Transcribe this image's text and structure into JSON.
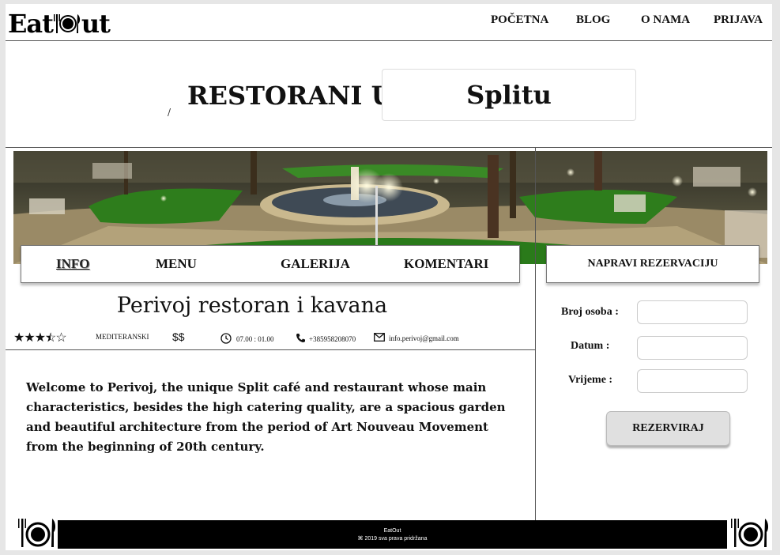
{
  "header": {
    "logo_left": "Eat",
    "logo_right": "ut",
    "nav": [
      "POČETNA",
      "BLOG",
      "O NAMA",
      "PRIJAVA"
    ]
  },
  "hero": {
    "title": "RESTORANI U:",
    "tick": "/",
    "city": "Splitu"
  },
  "tabs": [
    "INFO",
    "MENU",
    "GALERIJA",
    "KOMENTARI"
  ],
  "active_tab": "INFO",
  "reservation": {
    "header": "NAPRAVI REZERVACIJU",
    "persons_label": "Broj osoba :",
    "date_label": "Datum :",
    "time_label": "Vrijeme :",
    "persons_value": "",
    "date_value": "",
    "time_value": "",
    "submit": "REZERVIRAJ"
  },
  "restaurant": {
    "name": "Perivoj restoran i kavana",
    "rating": 3.5,
    "rating_max": 5,
    "cuisine": "MEDITERANSKI",
    "price": "$$",
    "hours": "07.00 : 01.00",
    "phone": "+385958208070",
    "email": "info.perivoj@gmail.com",
    "description": "Welcome to Perivoj, the unique Split café and restaurant whose main characteristics, besides the high catering quality, are a spacious garden and beautiful architecture from the period of Art Nouveau Movement from the beginning of 20th century."
  },
  "footer": {
    "brand": "EatOut",
    "copyright": "2019 sva prava pridržana"
  },
  "icons": {
    "logo": "plate-fork-knife-icon",
    "clock": "clock-icon",
    "phone": "phone-icon",
    "email": "envelope-icon",
    "footer": "plate-fork-knife-icon"
  },
  "colors": {
    "footer_bg": "#000000",
    "button_bg": "#e0e0e0",
    "text": "#111111"
  }
}
